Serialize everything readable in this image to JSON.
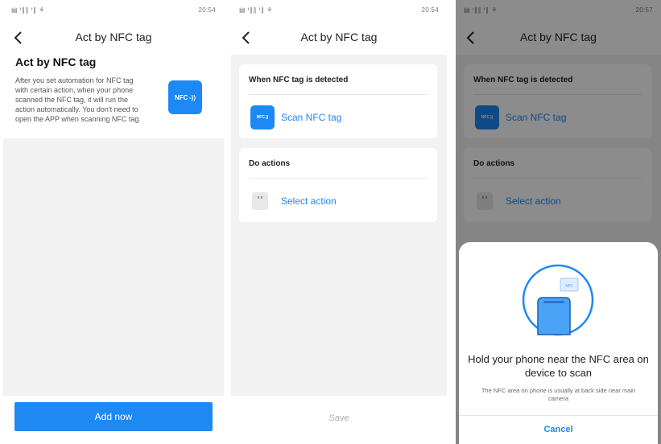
{
  "status_left": "▤ ᵗ∥∥ ᵗ∥ ⚘",
  "panel1": {
    "time": "20:54",
    "nav_title": "Act by NFC tag",
    "heading": "Act by NFC tag",
    "description": "After you set automation for NFC tag with certain action, when your phone scanned the NFC tag, it will run the action automatically. You don't need to open the APP when scanning NFC tag.",
    "badge_text": "NFC ‑))",
    "add_button": "Add now"
  },
  "panel2": {
    "time": "20:54",
    "nav_title": "Act by NFC tag",
    "trigger_section": "When NFC tag is detected",
    "scan_label": "Scan NFC tag",
    "nfc_icon_text": "NFC ))",
    "actions_section": "Do actions",
    "select_label": "Select action",
    "save_label": "Save"
  },
  "panel3": {
    "time": "20:57",
    "nav_title": "Act by NFC tag",
    "trigger_section": "When NFC tag is detected",
    "scan_label": "Scan NFC tag",
    "nfc_icon_text": "NFC ))",
    "actions_section": "Do actions",
    "select_label": "Select action",
    "sheet_title": "Hold your phone near the NFC area on device to scan",
    "sheet_subtitle": "The NFC area on phone is usually at back side near main camera",
    "illustration_tag_text": "NFC",
    "cancel_label": "Cancel"
  },
  "colors": {
    "accent": "#1e88f5",
    "background": "#f2f2f2"
  }
}
